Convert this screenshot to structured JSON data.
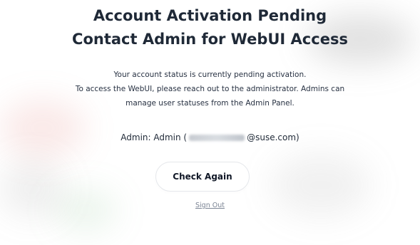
{
  "header": {
    "title_line_1": "Account Activation Pending",
    "title_line_2": "Contact Admin for WebUI Access"
  },
  "message": {
    "line_1": "Your account status is currently pending activation.",
    "line_2": "To access the WebUI, please reach out to the administrator. Admins can",
    "line_3": "manage user statuses from the Admin Panel."
  },
  "admin": {
    "prefix": "Admin: Admin (",
    "email_domain": "@suse.com)"
  },
  "actions": {
    "check_again_label": "Check Again",
    "sign_out_label": "Sign Out"
  }
}
